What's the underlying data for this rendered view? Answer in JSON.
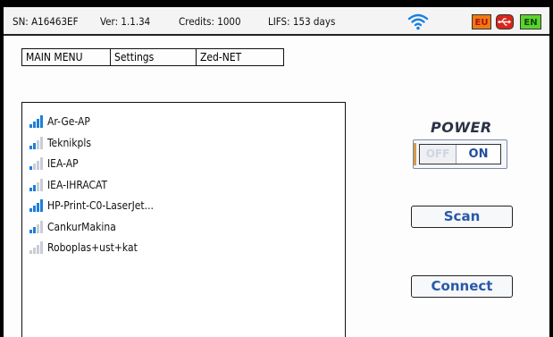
{
  "status": {
    "serial": "SN: A16463EF",
    "version": "Ver: 1.1.34",
    "credits": "Credits: 1000",
    "life": "LIFS: 153 days",
    "wifi_icon": "wifi-icon",
    "wifi_color": "#1a7fe0",
    "badge_eu": "EU",
    "usb_icon": "usb-icon",
    "badge_en": "EN"
  },
  "tabs": {
    "main": "MAIN MENU",
    "settings": "Settings",
    "zed": "Zed-NET"
  },
  "networks": [
    {
      "ssid": "Ar-Ge-AP",
      "bars": 4
    },
    {
      "ssid": "Teknikpls",
      "bars": 2
    },
    {
      "ssid": "IEA-AP",
      "bars": 1
    },
    {
      "ssid": "IEA-IHRACAT",
      "bars": 2
    },
    {
      "ssid": "HP-Print-C0-LaserJet...",
      "bars": 4
    },
    {
      "ssid": "CankurMakina",
      "bars": 2
    },
    {
      "ssid": "Roboplas+ust+kat",
      "bars": 0
    }
  ],
  "power": {
    "label": "POWER",
    "off_label": "OFF",
    "on_label": "ON",
    "state": "ON"
  },
  "buttons": {
    "scan": "Scan",
    "connect": "Connect"
  },
  "colors": {
    "accent": "#2859a8",
    "signal_on": "#1e7fd8",
    "signal_off": "#c8cdd6"
  }
}
